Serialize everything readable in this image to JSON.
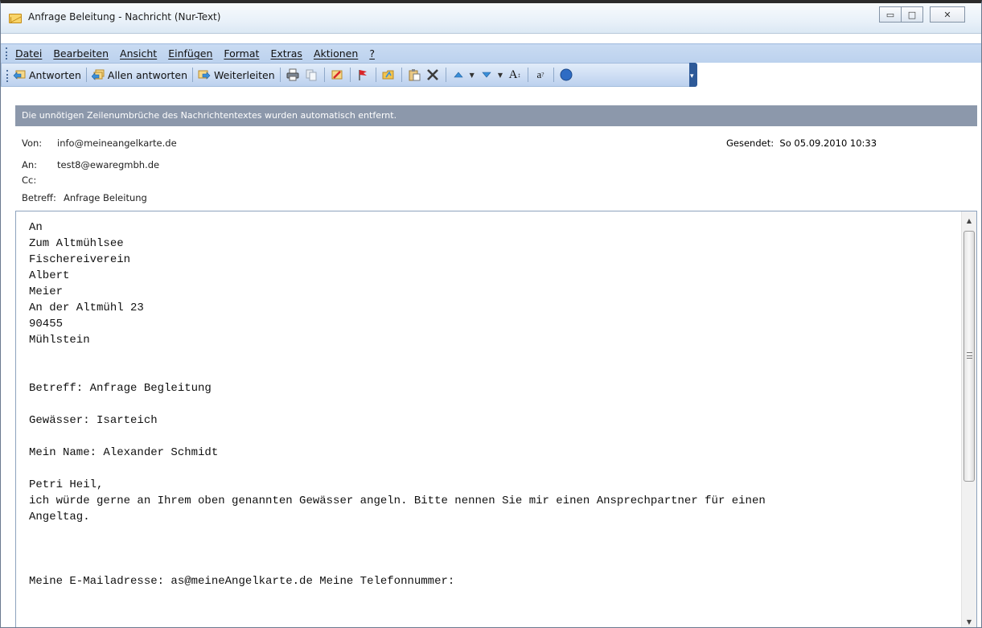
{
  "window": {
    "title": "Anfrage Beleitung - Nachricht (Nur-Text)",
    "minimize_glyph": "▭",
    "maximize_glyph": "□",
    "close_glyph": "✕"
  },
  "menu": {
    "items": [
      "Datei",
      "Bearbeiten",
      "Ansicht",
      "Einfügen",
      "Format",
      "Extras",
      "Aktionen",
      "?"
    ]
  },
  "toolbar": {
    "reply_label": "Antworten",
    "reply_all_label": "Allen antworten",
    "forward_label": "Weiterleiten",
    "icons": [
      "reply-icon",
      "reply-all-icon",
      "forward-icon",
      "print-icon",
      "copy-icon",
      "move-to-folder-icon",
      "flag-icon",
      "open-folder-icon",
      "paste-icon",
      "delete-icon",
      "previous-item-icon",
      "next-item-icon",
      "font-size-icon",
      "encoding-icon",
      "help-icon"
    ],
    "font_glyph": "A",
    "encoding_glyph": "a",
    "help_glyph": "?"
  },
  "infobar": {
    "text": "Die unnötigen Zeilenumbrüche des Nachrichtentextes wurden automatisch entfernt."
  },
  "header": {
    "from_label": "Von:",
    "from_value": "info@meineangelkarte.de",
    "to_label": "An:",
    "to_value": "test8@ewaregmbh.de",
    "cc_label": "Cc:",
    "cc_value": "",
    "subject_label": "Betreff:",
    "subject_value": "Anfrage Beleitung",
    "sent_label": "Gesendet:",
    "sent_value": "So 05.09.2010 10:33"
  },
  "body": {
    "text": "An\nZum Altmühlsee\nFischereiverein\nAlbert\nMeier\nAn der Altmühl 23\n90455\nMühlstein\n\n\nBetreff: Anfrage Begleitung\n\nGewässer: Isarteich\n\nMein Name: Alexander Schmidt\n\nPetri Heil,\nich würde gerne an Ihrem oben genannten Gewässer angeln. Bitte nennen Sie mir einen Ansprechpartner für einen\nAngeltag.\n\n\n\nMeine E-Mailadresse: as@meineAngelkarte.de Meine Telefonnummer:"
  },
  "scrollbar": {
    "up_glyph": "▲",
    "down_glyph": "▼"
  },
  "colors": {
    "infobar": "#8c98ab",
    "menubar": "#c9dbf2",
    "toolbar_end": "#2e5a98"
  }
}
